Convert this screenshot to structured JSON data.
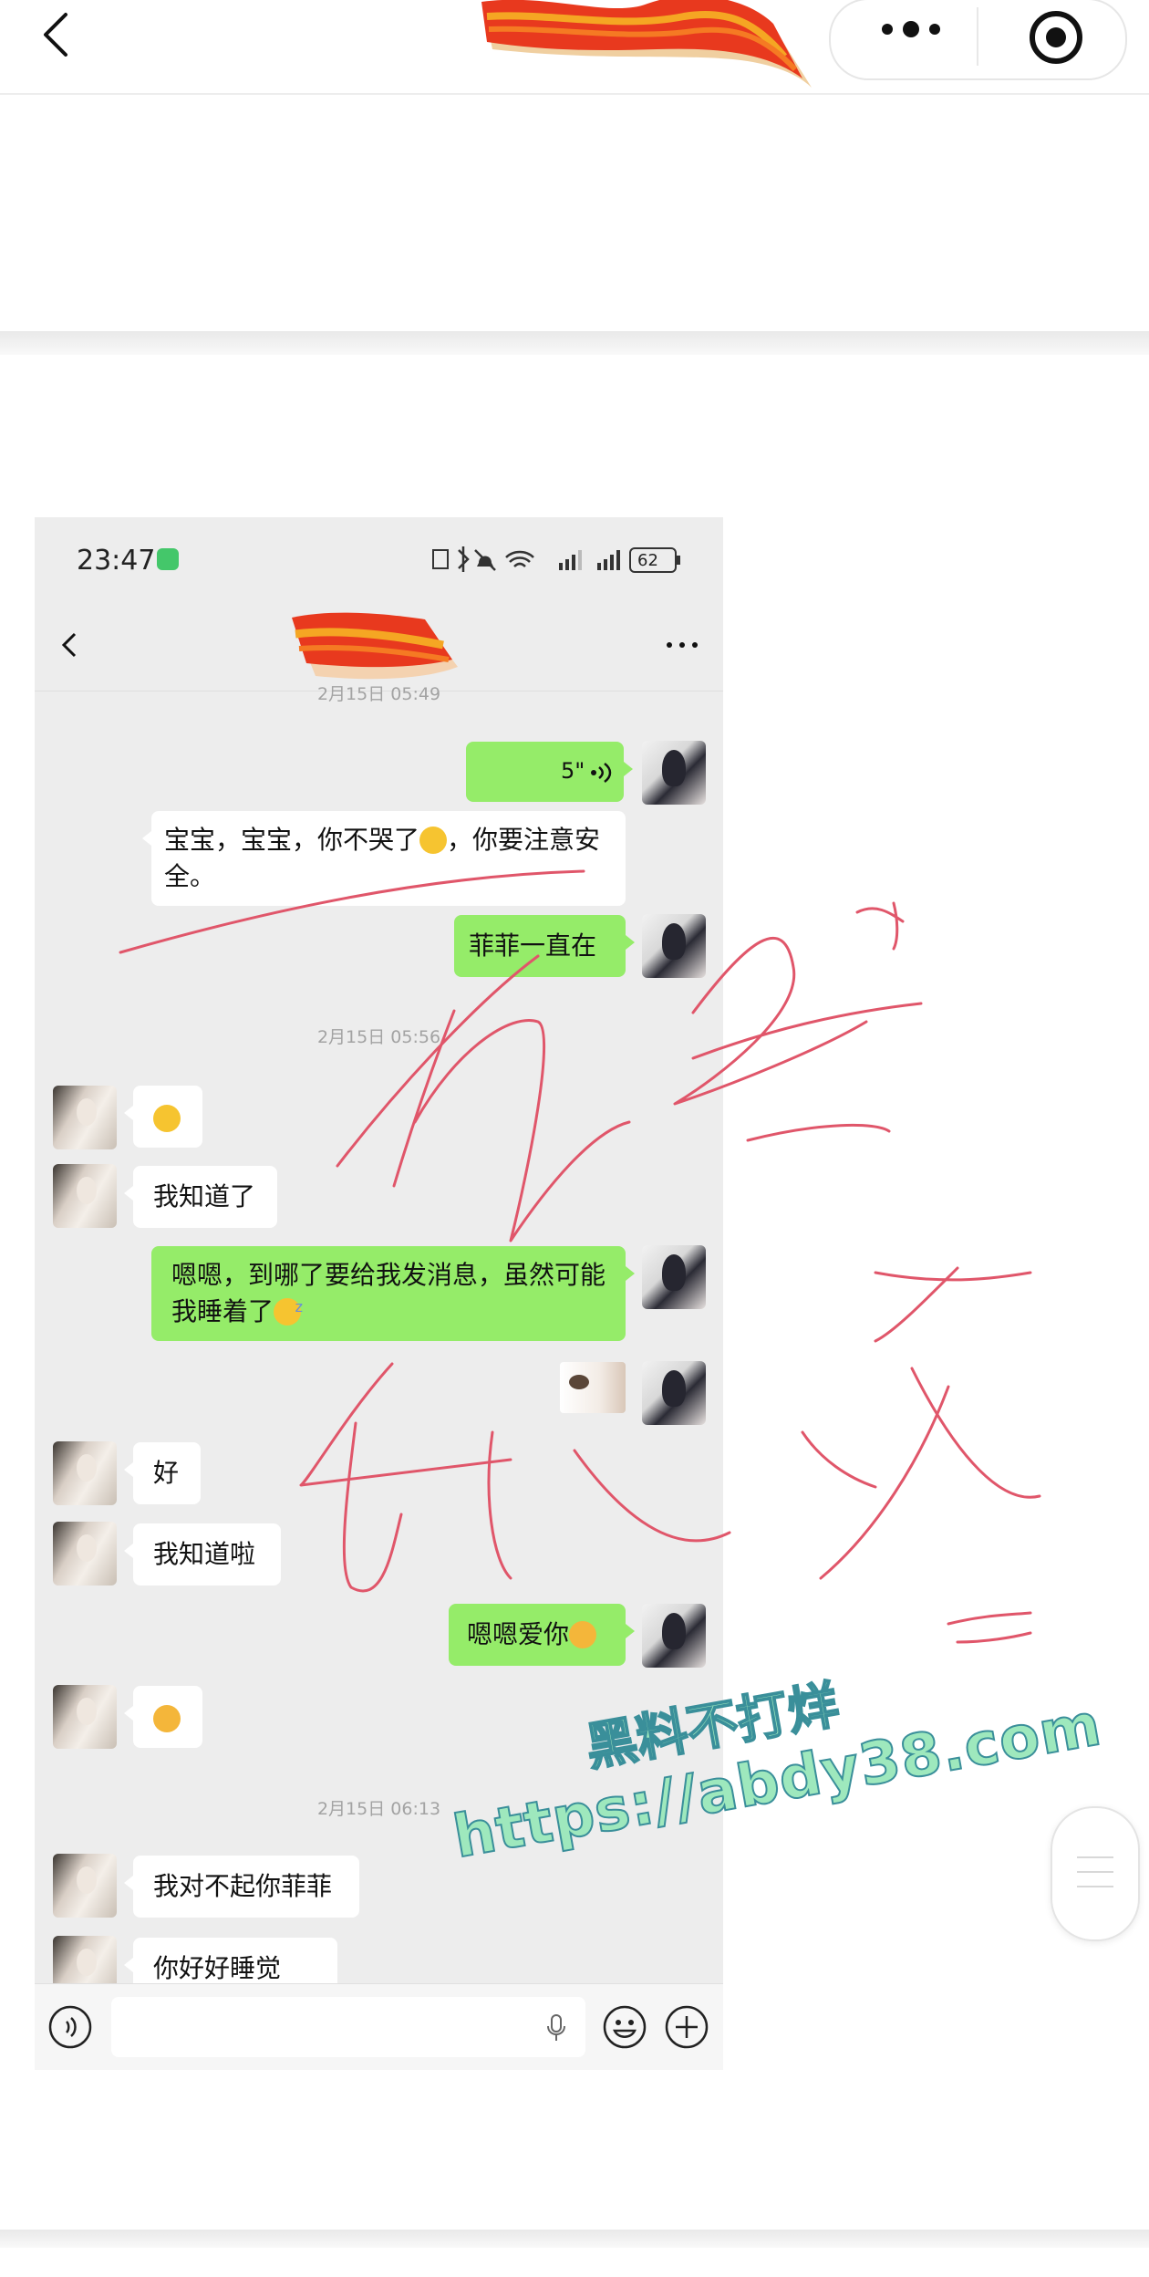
{
  "status_bar": {
    "time": "23:47",
    "battery": "62"
  },
  "messages": [
    {
      "type": "timestamp",
      "text": "2月15日 05:49"
    },
    {
      "type": "voice",
      "side": "me",
      "text": "5\""
    },
    {
      "type": "text",
      "side": "her",
      "text": "宝宝，宝宝，你不哭了",
      "after_emoji": "，你要注意安全。",
      "emoji": "crying"
    },
    {
      "type": "text",
      "side": "me",
      "text": "菲菲一直在"
    },
    {
      "type": "timestamp",
      "text": "2月15日 05:56"
    },
    {
      "type": "emoji",
      "side": "her",
      "emoji": "crying"
    },
    {
      "type": "text",
      "side": "her",
      "text": "我知道了"
    },
    {
      "type": "text",
      "side": "me",
      "text": "嗯嗯，到哪了要给我发消息，虽然可能我睡着了",
      "emoji": "sleepy"
    },
    {
      "type": "sticker",
      "side": "me"
    },
    {
      "type": "text",
      "side": "her",
      "text": "好"
    },
    {
      "type": "text",
      "side": "her",
      "text": "我知道啦"
    },
    {
      "type": "text",
      "side": "me",
      "text": "嗯嗯爱你",
      "emoji": "angry"
    },
    {
      "type": "emoji",
      "side": "her",
      "emoji": "angry"
    },
    {
      "type": "timestamp",
      "text": "2月15日 06:13"
    },
    {
      "type": "text",
      "side": "her",
      "text": "我对不起你菲菲"
    },
    {
      "type": "text",
      "side": "her",
      "text": "你好好睡觉"
    }
  ],
  "watermark": {
    "line1": "黑料不打烊",
    "line2": "https://abdy38.com"
  },
  "colors": {
    "my_bubble": "#95ec69",
    "her_bubble": "#ffffff",
    "chat_bg": "#ededed",
    "annotation_ink": "#e0566a",
    "redaction": "#e8391e"
  },
  "icons": [
    "back-icon",
    "more-dots-icon",
    "record-icon",
    "voice-icon",
    "mic-icon",
    "emoji-icon",
    "plus-icon"
  ]
}
